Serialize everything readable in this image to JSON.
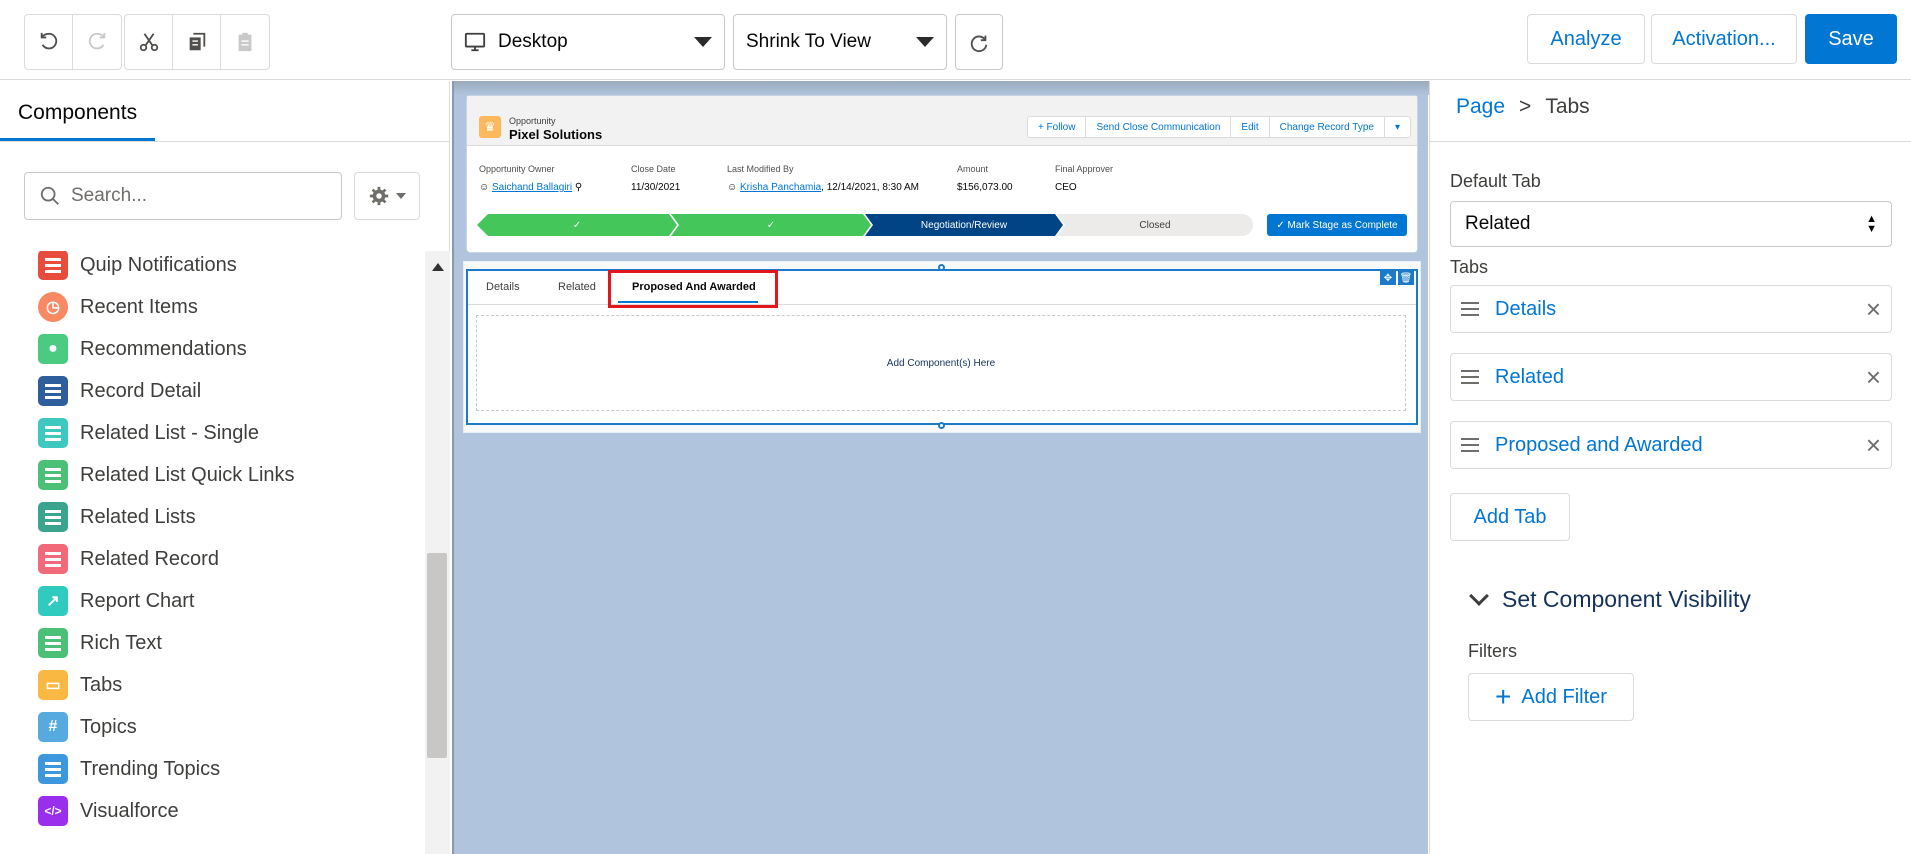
{
  "toolbar": {
    "device": "Desktop",
    "zoom": "Shrink To View",
    "analyze": "Analyze",
    "activation": "Activation...",
    "save": "Save"
  },
  "left": {
    "tab": "Components",
    "search_placeholder": "Search...",
    "components": [
      {
        "label": "Quip Notifications",
        "icon": "quip-icon",
        "color": "#e74c3c"
      },
      {
        "label": "Recent Items",
        "icon": "clock-icon",
        "color": "#f88962"
      },
      {
        "label": "Recommendations",
        "icon": "lightbulb-icon",
        "color": "#4bca81"
      },
      {
        "label": "Record Detail",
        "icon": "record-detail-icon",
        "color": "#2e5e9b"
      },
      {
        "label": "Related List - Single",
        "icon": "related-list-icon",
        "color": "#3ec9c0"
      },
      {
        "label": "Related List Quick Links",
        "icon": "quick-links-icon",
        "color": "#4bc076"
      },
      {
        "label": "Related Lists",
        "icon": "related-lists-icon",
        "color": "#3ba48f"
      },
      {
        "label": "Related Record",
        "icon": "related-record-icon",
        "color": "#f26979"
      },
      {
        "label": "Report Chart",
        "icon": "report-chart-icon",
        "color": "#2ecbbe"
      },
      {
        "label": "Rich Text",
        "icon": "rich-text-icon",
        "color": "#4bc076"
      },
      {
        "label": "Tabs",
        "icon": "tabs-icon",
        "color": "#f9b842"
      },
      {
        "label": "Topics",
        "icon": "hashtag-icon",
        "color": "#56aadf",
        "glyph": "#"
      },
      {
        "label": "Trending Topics",
        "icon": "list-icon",
        "color": "#3c97dd"
      },
      {
        "label": "Visualforce",
        "icon": "code-icon",
        "color": "#9a2eed",
        "glyph": "</>"
      }
    ]
  },
  "record": {
    "object": "Opportunity",
    "name": "Pixel Solutions",
    "actions": [
      "+ Follow",
      "Send Close Communication",
      "Edit",
      "Change Record Type"
    ],
    "fields": [
      {
        "label": "Opportunity Owner",
        "value": "Saichand Ballagiri"
      },
      {
        "label": "Close Date",
        "value": "11/30/2021"
      },
      {
        "label": "Last Modified By",
        "value": "Krisha Panchamia",
        "suffix": ", 12/14/2021, 8:30 AM"
      },
      {
        "label": "Amount",
        "value": "$156,073.00"
      },
      {
        "label": "Final Approver",
        "value": "CEO"
      }
    ],
    "path": {
      "current": "Negotiation/Review",
      "next": "Closed",
      "button": "Mark Stage as Complete"
    }
  },
  "canvas_tabs": {
    "tabs": [
      "Details",
      "Related",
      "Proposed And Awarded"
    ],
    "drop_text": "Add Component(s) Here"
  },
  "right": {
    "crumb_page": "Page",
    "crumb_sep": ">",
    "crumb_current": "Tabs",
    "default_tab_label": "Default Tab",
    "default_tab_value": "Related",
    "tabs_label": "Tabs",
    "tabs": [
      "Details",
      "Related",
      "Proposed and Awarded"
    ],
    "add_tab": "Add Tab",
    "visibility_title": "Set Component Visibility",
    "filters_label": "Filters",
    "add_filter": "Add Filter"
  }
}
